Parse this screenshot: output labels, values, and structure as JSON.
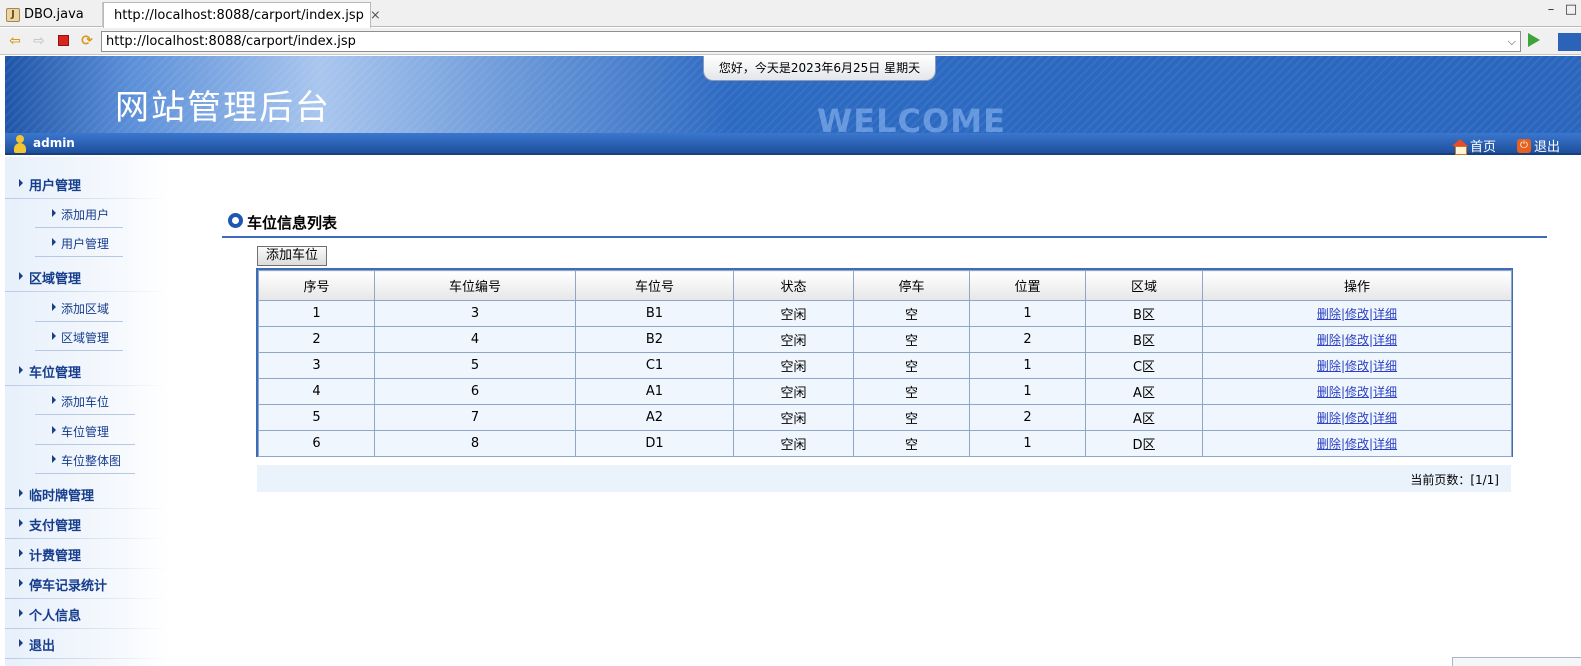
{
  "browser": {
    "tabs": [
      {
        "label": "DBO.java",
        "icon": "java-file-icon"
      },
      {
        "label": "http://localhost:8088/carport/index.jsp",
        "icon": "globe-icon"
      }
    ],
    "close_glyph": "⨯",
    "url": "http://localhost:8088/carport/index.jsp"
  },
  "header": {
    "site_title": "网站管理后台",
    "date_text": "您好，今天是2023年6月25日 星期天",
    "watermark": "WELCOME"
  },
  "userbar": {
    "username": "admin",
    "home_label": "首页",
    "logout_label": "退出"
  },
  "sidebar": {
    "groups": [
      {
        "label": "用户管理",
        "items": [
          "添加用户",
          "用户管理"
        ]
      },
      {
        "label": "区域管理",
        "items": [
          "添加区域",
          "区域管理"
        ]
      },
      {
        "label": "车位管理",
        "items": [
          "添加车位",
          "车位管理",
          "车位整体图"
        ]
      },
      {
        "label": "临时牌管理",
        "items": []
      },
      {
        "label": "支付管理",
        "items": []
      },
      {
        "label": "计费管理",
        "items": []
      },
      {
        "label": "停车记录统计",
        "items": []
      },
      {
        "label": "个人信息",
        "items": []
      },
      {
        "label": "退出",
        "items": []
      }
    ]
  },
  "main": {
    "section_title": "车位信息列表",
    "add_button": "添加车位",
    "table": {
      "columns": [
        "序号",
        "车位编号",
        "车位号",
        "状态",
        "停车",
        "位置",
        "区域",
        "操作"
      ],
      "rows": [
        [
          "1",
          "3",
          "B1",
          "空闲",
          "空",
          "1",
          "B区"
        ],
        [
          "2",
          "4",
          "B2",
          "空闲",
          "空",
          "2",
          "B区"
        ],
        [
          "3",
          "5",
          "C1",
          "空闲",
          "空",
          "1",
          "C区"
        ],
        [
          "4",
          "6",
          "A1",
          "空闲",
          "空",
          "1",
          "A区"
        ],
        [
          "5",
          "7",
          "A2",
          "空闲",
          "空",
          "2",
          "A区"
        ],
        [
          "6",
          "8",
          "D1",
          "空闲",
          "空",
          "1",
          "D区"
        ]
      ],
      "actions": [
        "删除",
        "修改",
        "详细"
      ],
      "action_separator": "|"
    },
    "pager": "当前页数：[1/1]"
  },
  "colors": {
    "header_blue": "#2a66be",
    "menu_text": "#163d8c",
    "link": "#2a3fc1",
    "table_border": "#3c6cb6"
  }
}
